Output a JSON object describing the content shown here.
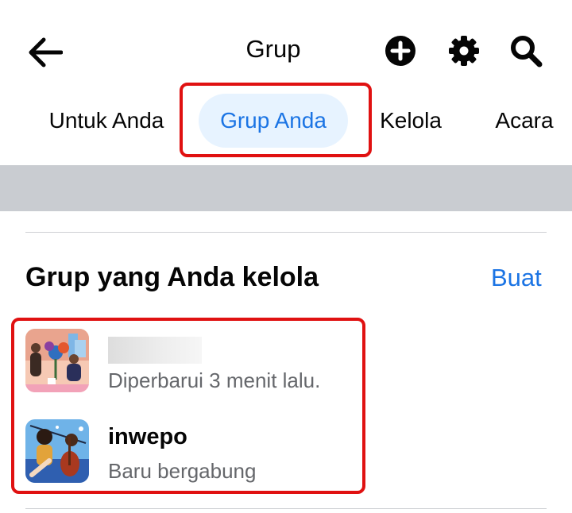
{
  "header": {
    "title": "Grup",
    "back_icon": "arrow-left-icon",
    "actions": [
      {
        "icon": "plus-circle-icon"
      },
      {
        "icon": "gear-icon"
      },
      {
        "icon": "search-icon"
      }
    ]
  },
  "tabs": [
    {
      "label": "Untuk Anda",
      "active": false
    },
    {
      "label": "Grup Anda",
      "active": true
    },
    {
      "label": "Kelola",
      "active": false
    },
    {
      "label": "Acara",
      "active": false
    }
  ],
  "section": {
    "title": "Grup yang Anda kelola",
    "create_label": "Buat"
  },
  "groups": [
    {
      "name": "",
      "subtitle": "Diperbarui 3 menit lalu."
    },
    {
      "name": "inwepo",
      "subtitle": "Baru bergabung"
    }
  ],
  "colors": {
    "accent": "#1b74e4",
    "active_tab_bg": "#e7f3ff",
    "highlight": "#e01111",
    "band": "#c9ccd1",
    "secondary_text": "#65676b"
  }
}
